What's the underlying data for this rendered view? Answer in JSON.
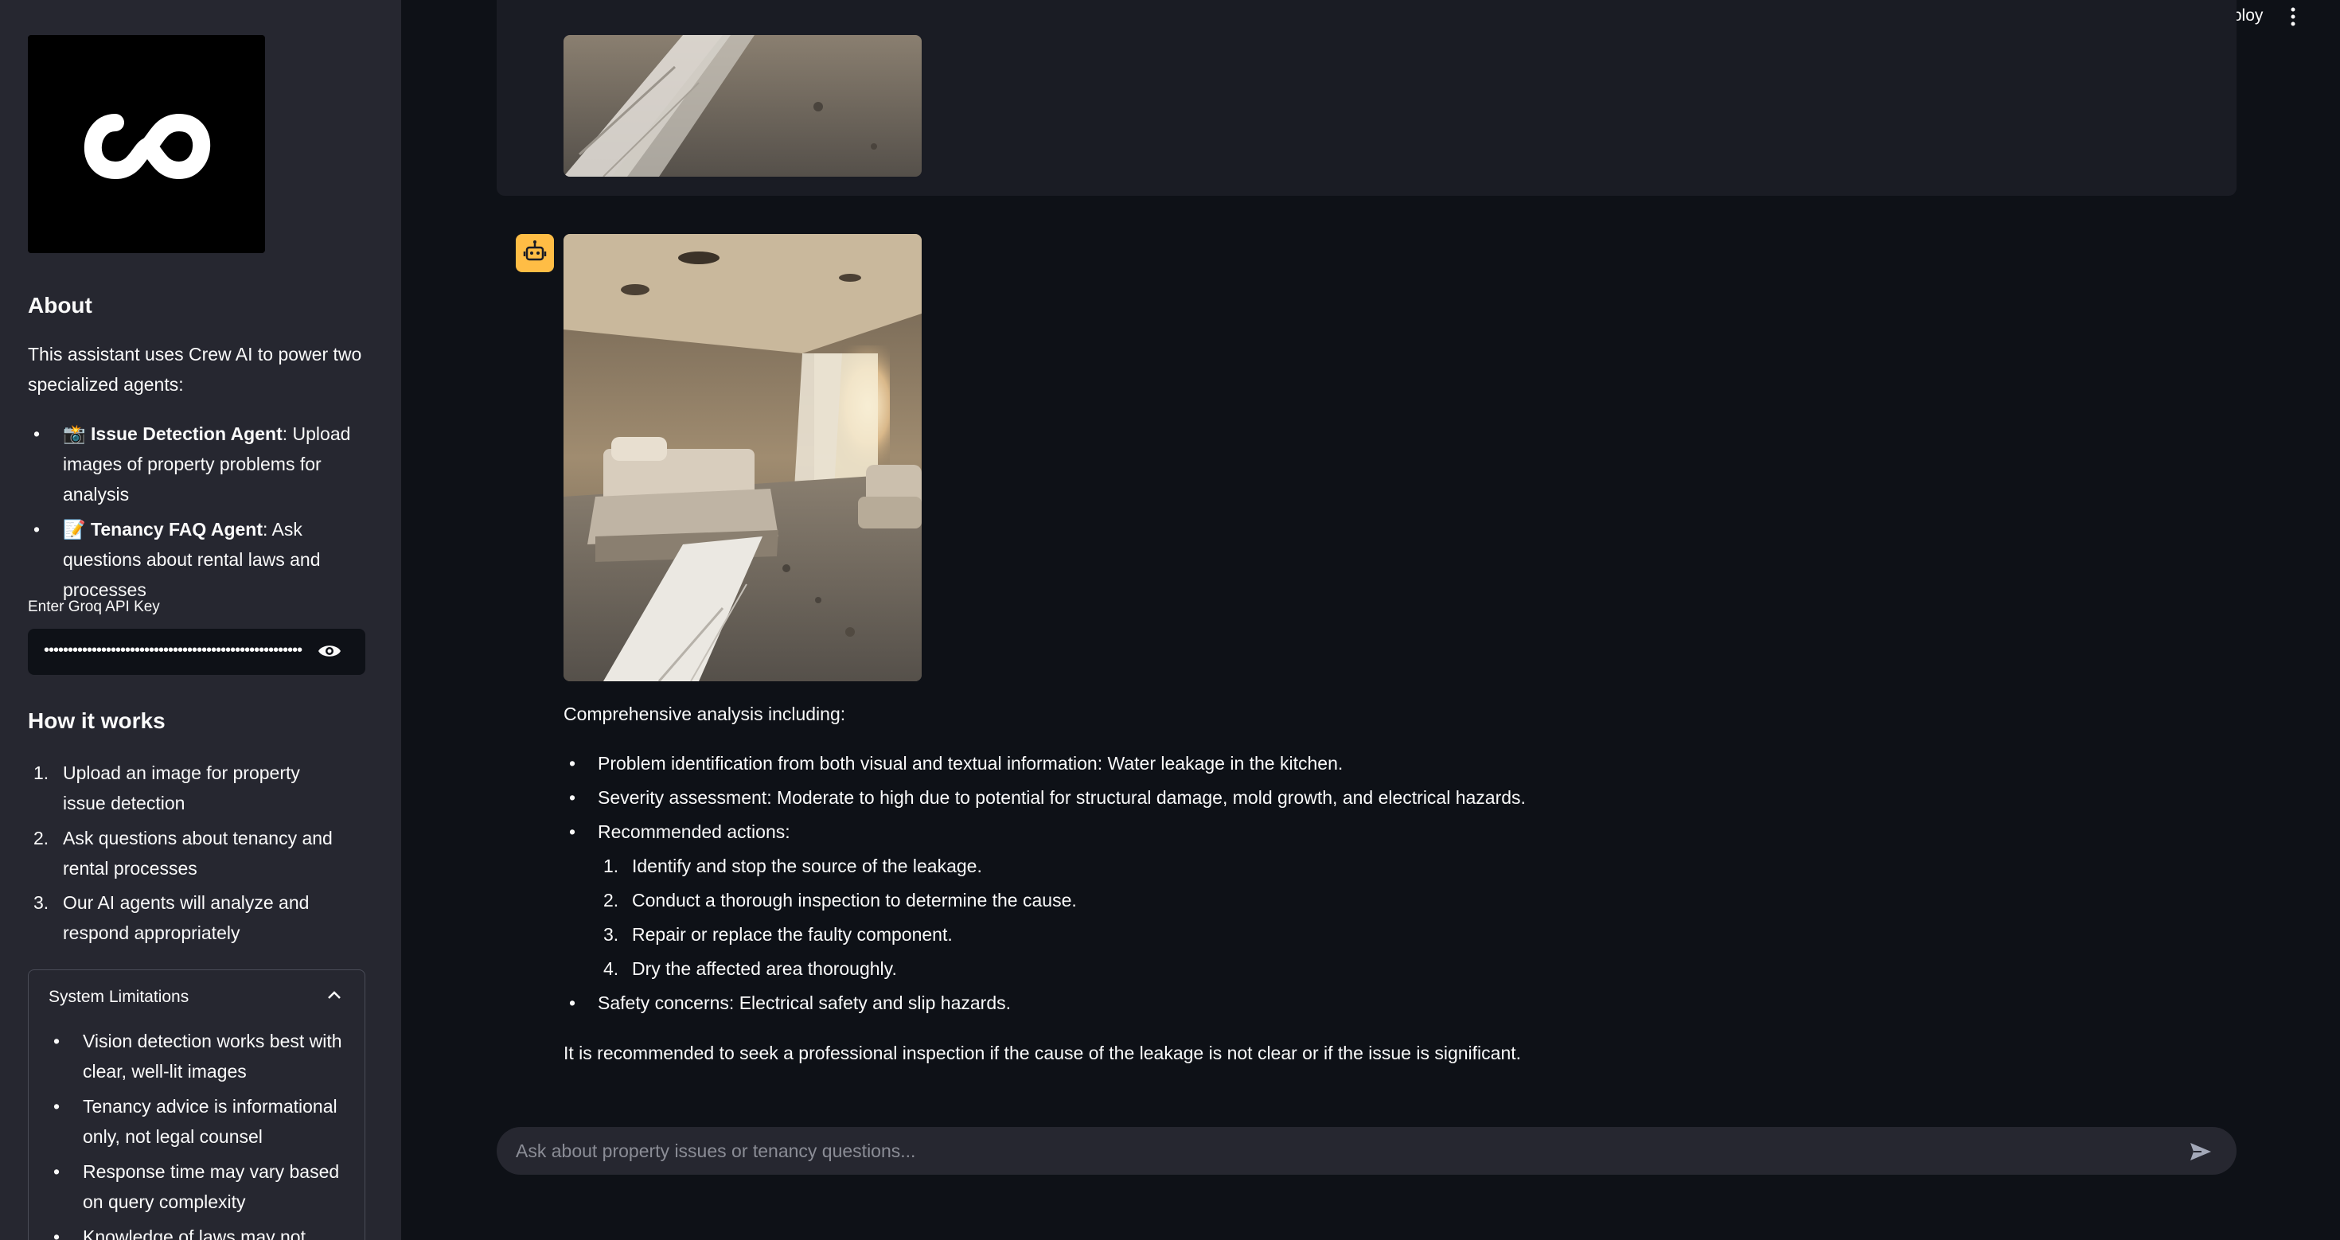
{
  "header": {
    "deploy_label": "Deploy"
  },
  "sidebar": {
    "about_title": "About",
    "about_text": "This assistant uses Crew AI to power two specialized agents:",
    "agents": [
      {
        "icon": "📸",
        "name": "Issue Detection Agent",
        "desc": ": Upload images of property problems for analysis"
      },
      {
        "icon": "📝",
        "name": "Tenancy FAQ Agent",
        "desc": ": Ask questions about rental laws and processes"
      }
    ],
    "api_key_label": "Enter Groq API Key",
    "api_key_value": "••••••••••••••••••••••••••••••••••••••••••••••••••••••",
    "how_title": "How it works",
    "steps": [
      "Upload an image for property issue detection",
      "Ask questions about tenancy and rental processes",
      "Our AI agents will analyze and respond appropriately"
    ],
    "limitations_title": "System Limitations",
    "limitations": [
      "Vision detection works best with clear, well-lit images",
      "Tenancy advice is informational only, not legal counsel",
      "Response time may vary based on query complexity",
      "Knowledge of laws may not"
    ]
  },
  "chat": {
    "intro": "Comprehensive analysis including:",
    "bullets": [
      "Problem identification from both visual and textual information: Water leakage in the kitchen.",
      "Severity assessment: Moderate to high due to potential for structural damage, mold growth, and electrical hazards.",
      "Recommended actions:"
    ],
    "actions": [
      "Identify and stop the source of the leakage.",
      "Conduct a thorough inspection to determine the cause.",
      "Repair or replace the faulty component.",
      "Dry the affected area thoroughly."
    ],
    "safety": "Safety concerns: Electrical safety and slip hazards.",
    "closing": "It is recommended to seek a professional inspection if the cause of the leakage is not clear or if the issue is significant.",
    "input_placeholder": "Ask about property issues or tenancy questions..."
  },
  "colors": {
    "sidebar_bg": "#262730",
    "main_bg": "#0e1117",
    "avatar_bg": "#ffbd45"
  }
}
